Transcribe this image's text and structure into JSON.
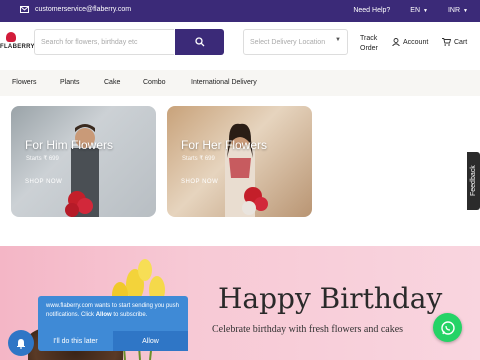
{
  "topbar": {
    "email": "customerservice@flaberry.com",
    "help": "Need Help?",
    "language": "EN",
    "currency": "INR"
  },
  "header": {
    "logo_text": "FLABERRY",
    "search_placeholder": "Search for flowers, birthday etc",
    "location_placeholder": "Select Delivery Location",
    "track_order": "Track Order",
    "account": "Account",
    "cart": "Cart"
  },
  "nav": {
    "items": [
      "Flowers",
      "Plants",
      "Cake",
      "Combo",
      "International Delivery"
    ]
  },
  "cards": [
    {
      "title": "For Him Flowers",
      "price": "Starts ₹ 699",
      "cta": "SHOP NOW"
    },
    {
      "title": "For Her Flowers",
      "price": "Starts ₹ 699",
      "cta": "SHOP NOW"
    }
  ],
  "banner": {
    "heading": "Happy Birthday",
    "subheading": "Celebrate birthday with fresh flowers and cakes"
  },
  "feedback": {
    "label": "Feedback"
  },
  "push": {
    "message_prefix": "www.flaberry.com wants to start sending you push notifications. Click ",
    "message_bold": "Allow",
    "message_suffix": " to subscribe.",
    "later": "I'll do this later",
    "allow": "Allow"
  },
  "colors": {
    "brand": "#3b2a78",
    "whatsapp": "#25d366",
    "push_bg": "#3f8ad6"
  }
}
